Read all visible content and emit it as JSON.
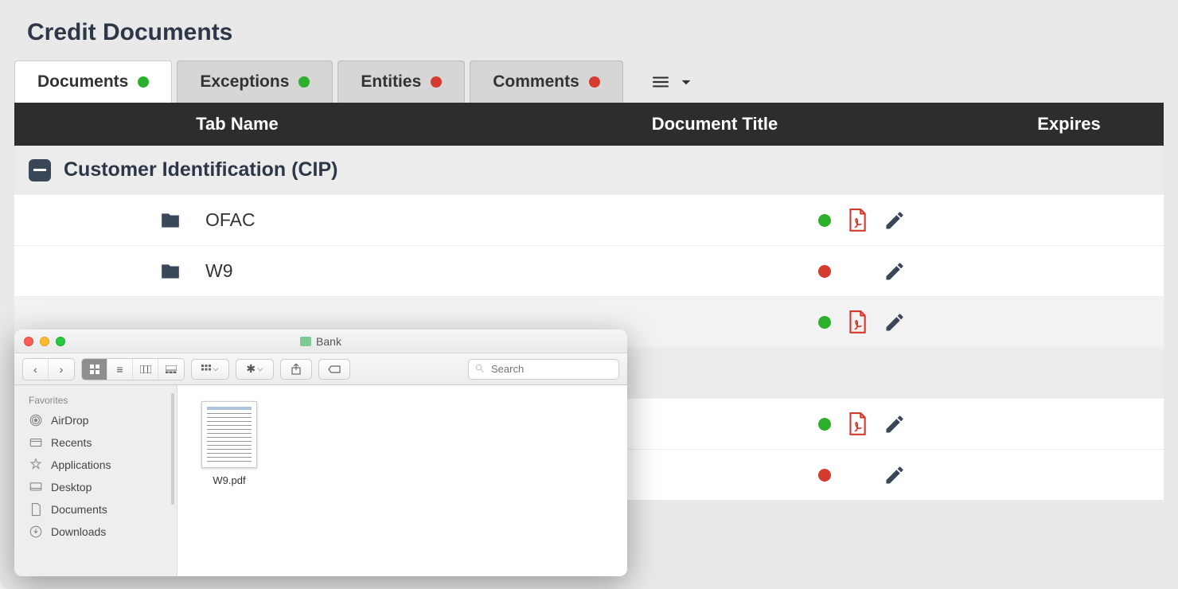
{
  "page": {
    "title": "Credit Documents"
  },
  "tabs": {
    "documents": {
      "label": "Documents",
      "status": "green",
      "active": true
    },
    "exceptions": {
      "label": "Exceptions",
      "status": "green"
    },
    "entities": {
      "label": "Entities",
      "status": "red"
    },
    "comments": {
      "label": "Comments",
      "status": "red"
    }
  },
  "columns": {
    "tab_name": "Tab Name",
    "doc_title": "Document Title",
    "expires": "Expires"
  },
  "group": {
    "title": "Customer Identification (CIP)"
  },
  "rows": [
    {
      "name": "OFAC",
      "status": "green",
      "has_pdf": true
    },
    {
      "name": "W9",
      "status": "red",
      "has_pdf": false
    },
    {
      "name": "",
      "status": "green",
      "has_pdf": true
    },
    {
      "name": "",
      "status": "green",
      "has_pdf": true
    },
    {
      "name": "",
      "status": "red",
      "has_pdf": false
    }
  ],
  "finder": {
    "title": "Bank",
    "search_placeholder": "Search",
    "sidebar": {
      "header": "Favorites",
      "items": [
        {
          "label": "AirDrop"
        },
        {
          "label": "Recents"
        },
        {
          "label": "Applications"
        },
        {
          "label": "Desktop"
        },
        {
          "label": "Documents"
        },
        {
          "label": "Downloads"
        }
      ]
    },
    "file": {
      "name": "W9.pdf"
    }
  }
}
